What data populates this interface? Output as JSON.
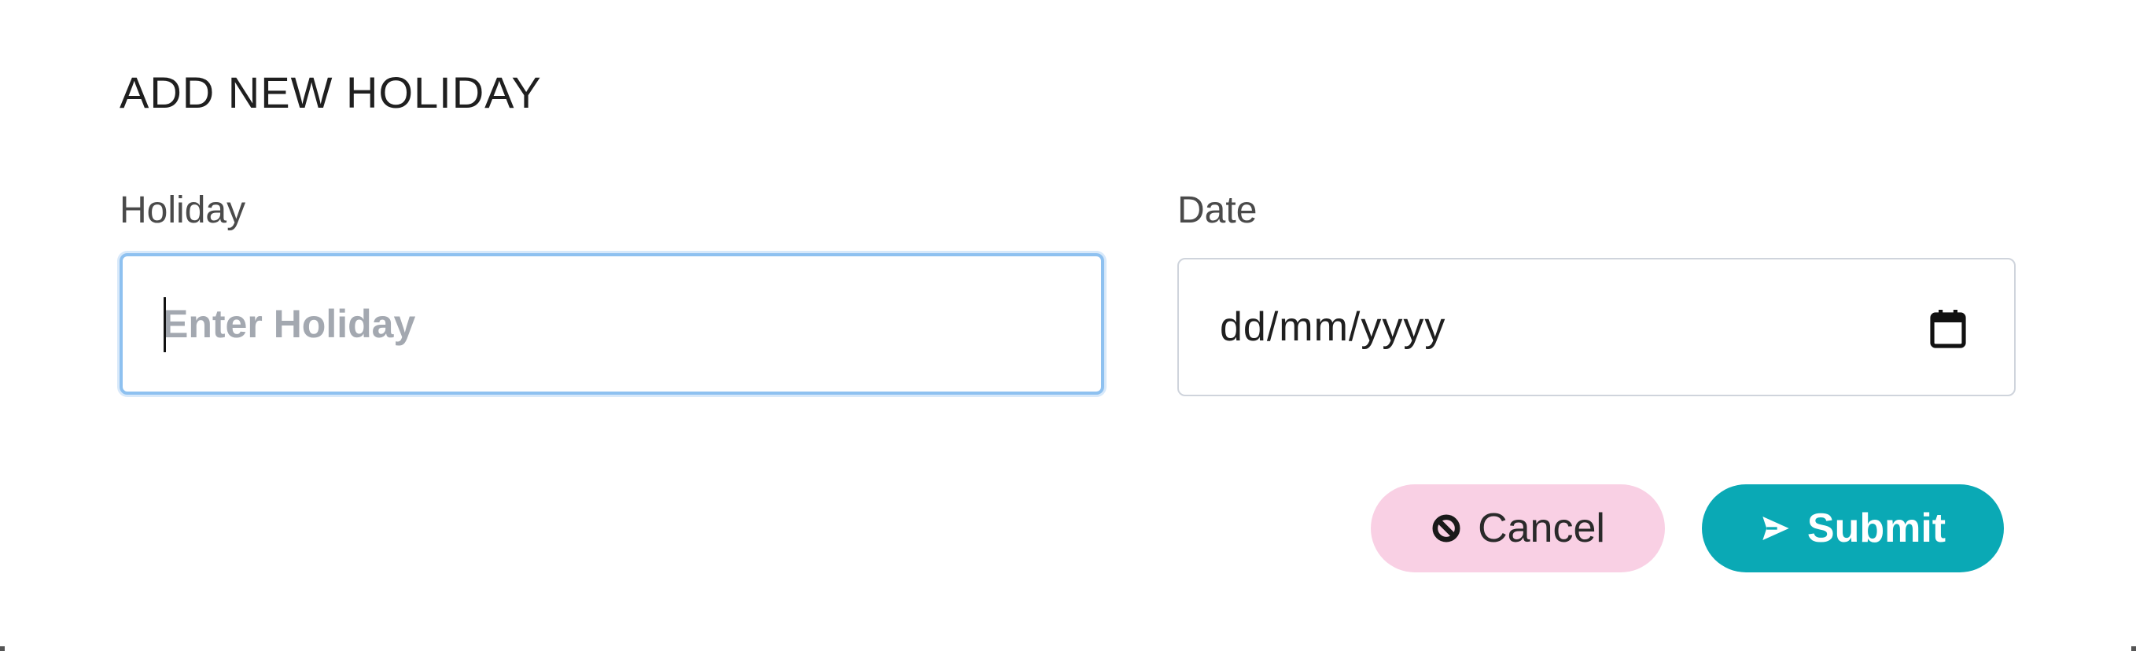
{
  "dialog": {
    "title": "ADD NEW HOLIDAY"
  },
  "form": {
    "holiday": {
      "label": "Holiday",
      "value": "",
      "placeholder": "Enter Holiday"
    },
    "date": {
      "label": "Date",
      "value": "dd/mm/yyyy",
      "icon": "calendar-icon"
    }
  },
  "actions": {
    "cancel": {
      "label": "Cancel",
      "icon": "ban-icon",
      "color": "#f9d0e4"
    },
    "submit": {
      "label": "Submit",
      "icon": "send-icon",
      "color": "#0aa9b5"
    }
  }
}
